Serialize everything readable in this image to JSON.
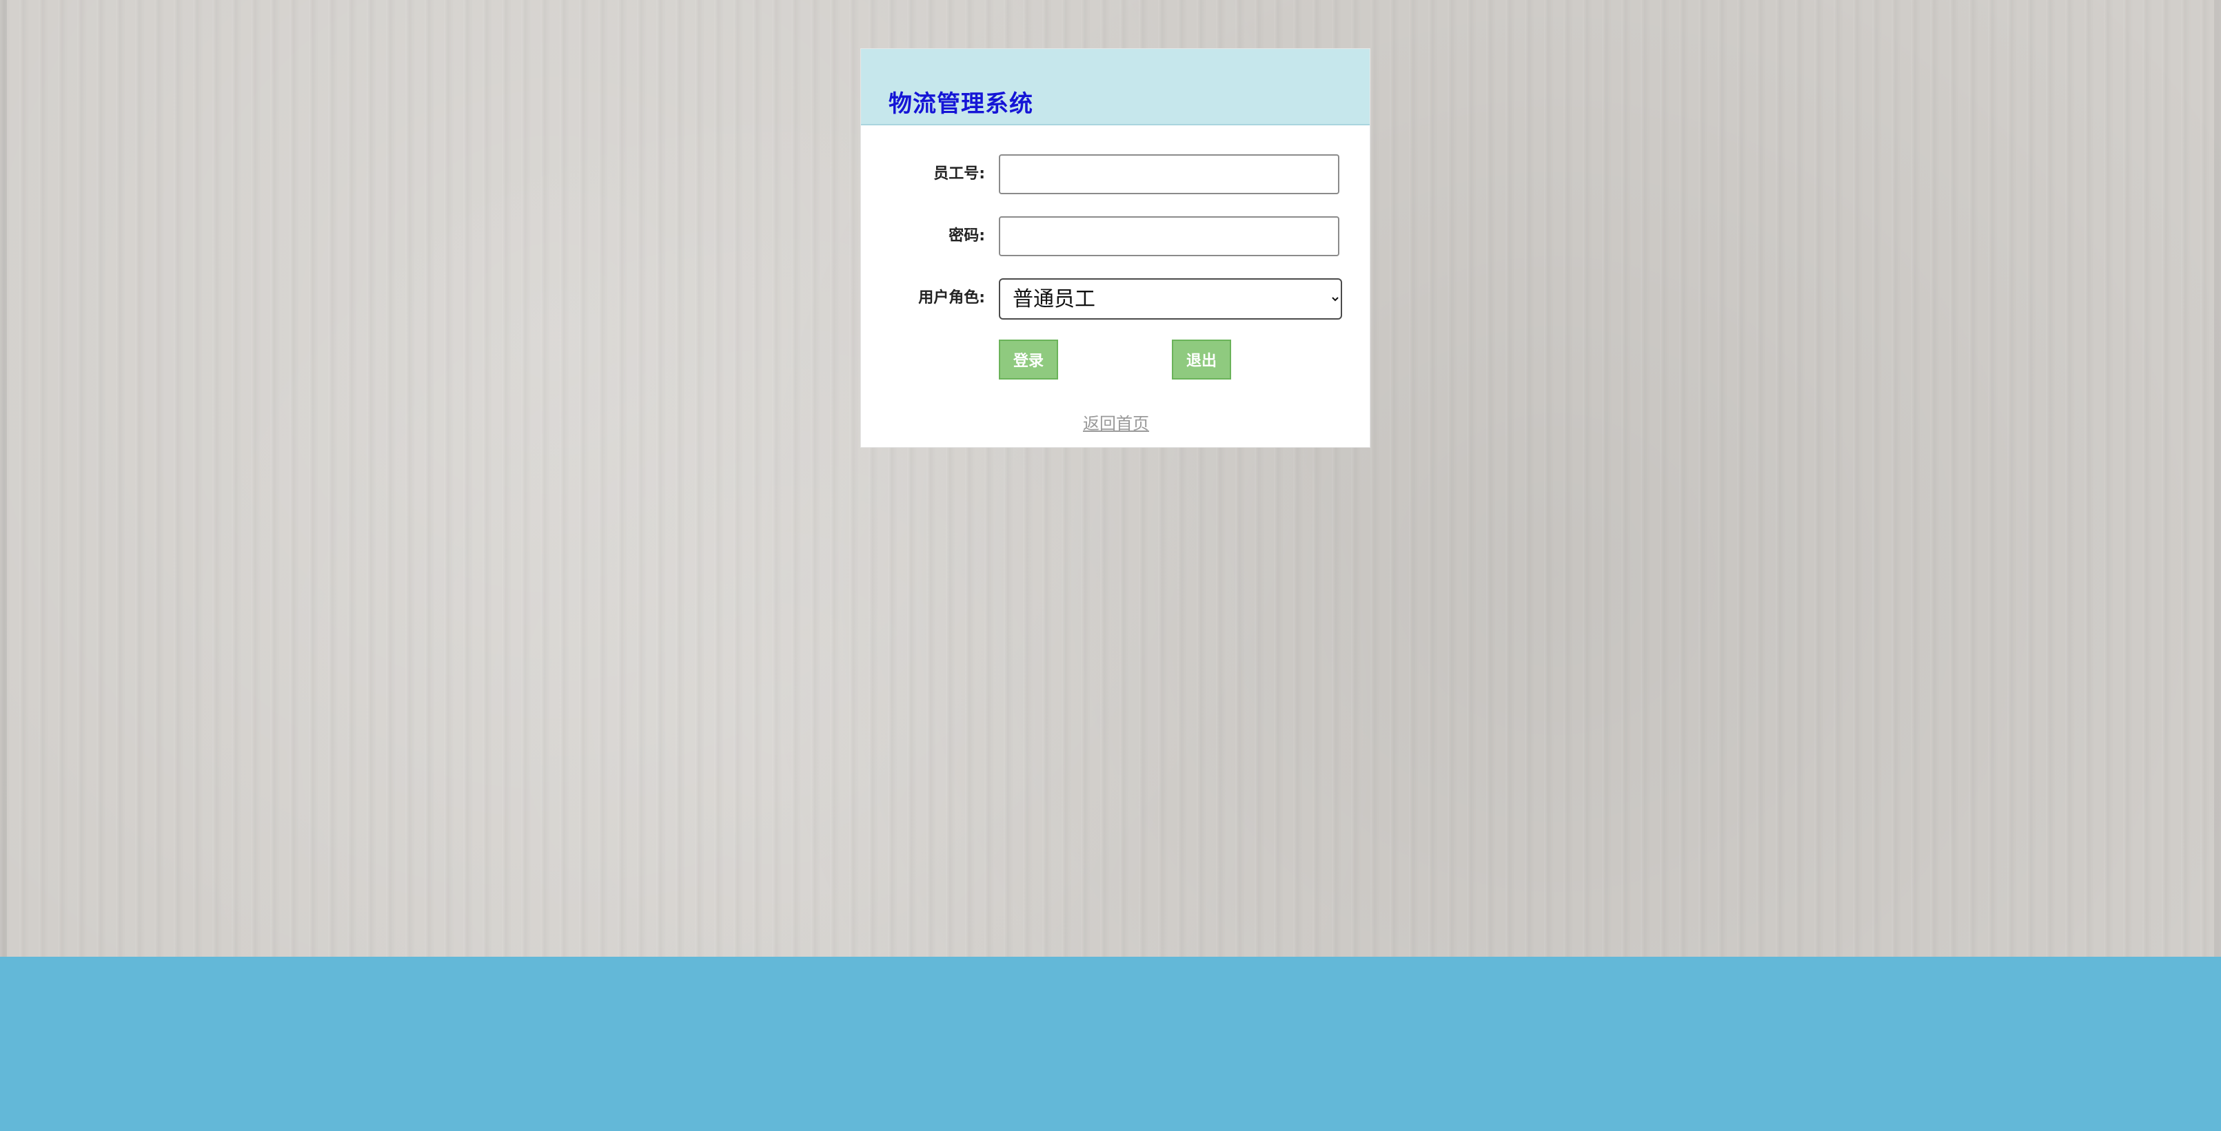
{
  "app": {
    "title": "物流管理系统"
  },
  "form": {
    "employee_id_label": "员工号:",
    "employee_id_value": "",
    "password_label": "密码:",
    "password_value": "",
    "role_label": "用户角色:",
    "role_selected": "普通员工"
  },
  "actions": {
    "login_label": "登录",
    "exit_label": "退出",
    "back_home_label": "返回首页"
  },
  "colors": {
    "header_bg": "#c6e7ec",
    "title_text": "#1515d6",
    "button_bg": "#8fca7f",
    "footer_bg": "#63b8d8"
  }
}
